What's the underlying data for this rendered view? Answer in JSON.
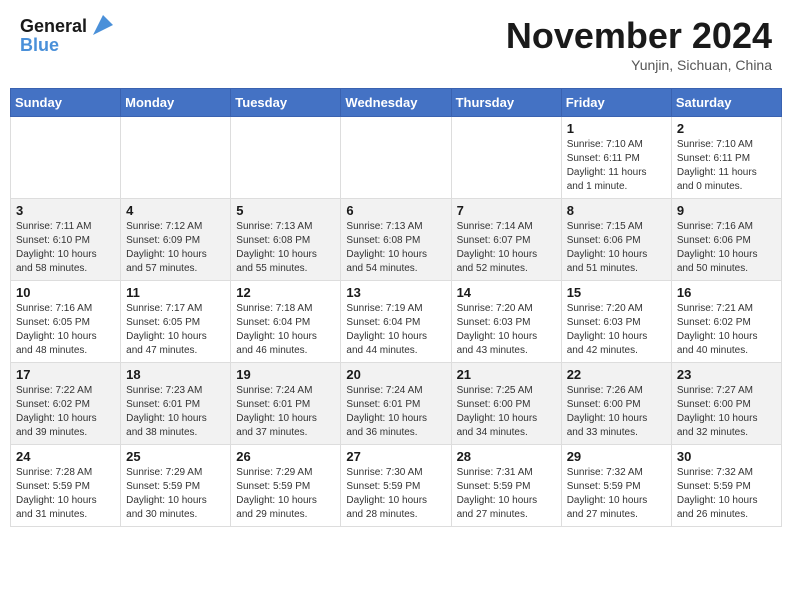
{
  "header": {
    "logo_line1": "General",
    "logo_line2": "Blue",
    "month_year": "November 2024",
    "location": "Yunjin, Sichuan, China"
  },
  "weekdays": [
    "Sunday",
    "Monday",
    "Tuesday",
    "Wednesday",
    "Thursday",
    "Friday",
    "Saturday"
  ],
  "weeks": [
    [
      {
        "day": "",
        "info": ""
      },
      {
        "day": "",
        "info": ""
      },
      {
        "day": "",
        "info": ""
      },
      {
        "day": "",
        "info": ""
      },
      {
        "day": "",
        "info": ""
      },
      {
        "day": "1",
        "info": "Sunrise: 7:10 AM\nSunset: 6:11 PM\nDaylight: 11 hours\nand 1 minute."
      },
      {
        "day": "2",
        "info": "Sunrise: 7:10 AM\nSunset: 6:11 PM\nDaylight: 11 hours\nand 0 minutes."
      }
    ],
    [
      {
        "day": "3",
        "info": "Sunrise: 7:11 AM\nSunset: 6:10 PM\nDaylight: 10 hours\nand 58 minutes."
      },
      {
        "day": "4",
        "info": "Sunrise: 7:12 AM\nSunset: 6:09 PM\nDaylight: 10 hours\nand 57 minutes."
      },
      {
        "day": "5",
        "info": "Sunrise: 7:13 AM\nSunset: 6:08 PM\nDaylight: 10 hours\nand 55 minutes."
      },
      {
        "day": "6",
        "info": "Sunrise: 7:13 AM\nSunset: 6:08 PM\nDaylight: 10 hours\nand 54 minutes."
      },
      {
        "day": "7",
        "info": "Sunrise: 7:14 AM\nSunset: 6:07 PM\nDaylight: 10 hours\nand 52 minutes."
      },
      {
        "day": "8",
        "info": "Sunrise: 7:15 AM\nSunset: 6:06 PM\nDaylight: 10 hours\nand 51 minutes."
      },
      {
        "day": "9",
        "info": "Sunrise: 7:16 AM\nSunset: 6:06 PM\nDaylight: 10 hours\nand 50 minutes."
      }
    ],
    [
      {
        "day": "10",
        "info": "Sunrise: 7:16 AM\nSunset: 6:05 PM\nDaylight: 10 hours\nand 48 minutes."
      },
      {
        "day": "11",
        "info": "Sunrise: 7:17 AM\nSunset: 6:05 PM\nDaylight: 10 hours\nand 47 minutes."
      },
      {
        "day": "12",
        "info": "Sunrise: 7:18 AM\nSunset: 6:04 PM\nDaylight: 10 hours\nand 46 minutes."
      },
      {
        "day": "13",
        "info": "Sunrise: 7:19 AM\nSunset: 6:04 PM\nDaylight: 10 hours\nand 44 minutes."
      },
      {
        "day": "14",
        "info": "Sunrise: 7:20 AM\nSunset: 6:03 PM\nDaylight: 10 hours\nand 43 minutes."
      },
      {
        "day": "15",
        "info": "Sunrise: 7:20 AM\nSunset: 6:03 PM\nDaylight: 10 hours\nand 42 minutes."
      },
      {
        "day": "16",
        "info": "Sunrise: 7:21 AM\nSunset: 6:02 PM\nDaylight: 10 hours\nand 40 minutes."
      }
    ],
    [
      {
        "day": "17",
        "info": "Sunrise: 7:22 AM\nSunset: 6:02 PM\nDaylight: 10 hours\nand 39 minutes."
      },
      {
        "day": "18",
        "info": "Sunrise: 7:23 AM\nSunset: 6:01 PM\nDaylight: 10 hours\nand 38 minutes."
      },
      {
        "day": "19",
        "info": "Sunrise: 7:24 AM\nSunset: 6:01 PM\nDaylight: 10 hours\nand 37 minutes."
      },
      {
        "day": "20",
        "info": "Sunrise: 7:24 AM\nSunset: 6:01 PM\nDaylight: 10 hours\nand 36 minutes."
      },
      {
        "day": "21",
        "info": "Sunrise: 7:25 AM\nSunset: 6:00 PM\nDaylight: 10 hours\nand 34 minutes."
      },
      {
        "day": "22",
        "info": "Sunrise: 7:26 AM\nSunset: 6:00 PM\nDaylight: 10 hours\nand 33 minutes."
      },
      {
        "day": "23",
        "info": "Sunrise: 7:27 AM\nSunset: 6:00 PM\nDaylight: 10 hours\nand 32 minutes."
      }
    ],
    [
      {
        "day": "24",
        "info": "Sunrise: 7:28 AM\nSunset: 5:59 PM\nDaylight: 10 hours\nand 31 minutes."
      },
      {
        "day": "25",
        "info": "Sunrise: 7:29 AM\nSunset: 5:59 PM\nDaylight: 10 hours\nand 30 minutes."
      },
      {
        "day": "26",
        "info": "Sunrise: 7:29 AM\nSunset: 5:59 PM\nDaylight: 10 hours\nand 29 minutes."
      },
      {
        "day": "27",
        "info": "Sunrise: 7:30 AM\nSunset: 5:59 PM\nDaylight: 10 hours\nand 28 minutes."
      },
      {
        "day": "28",
        "info": "Sunrise: 7:31 AM\nSunset: 5:59 PM\nDaylight: 10 hours\nand 27 minutes."
      },
      {
        "day": "29",
        "info": "Sunrise: 7:32 AM\nSunset: 5:59 PM\nDaylight: 10 hours\nand 27 minutes."
      },
      {
        "day": "30",
        "info": "Sunrise: 7:32 AM\nSunset: 5:59 PM\nDaylight: 10 hours\nand 26 minutes."
      }
    ]
  ]
}
